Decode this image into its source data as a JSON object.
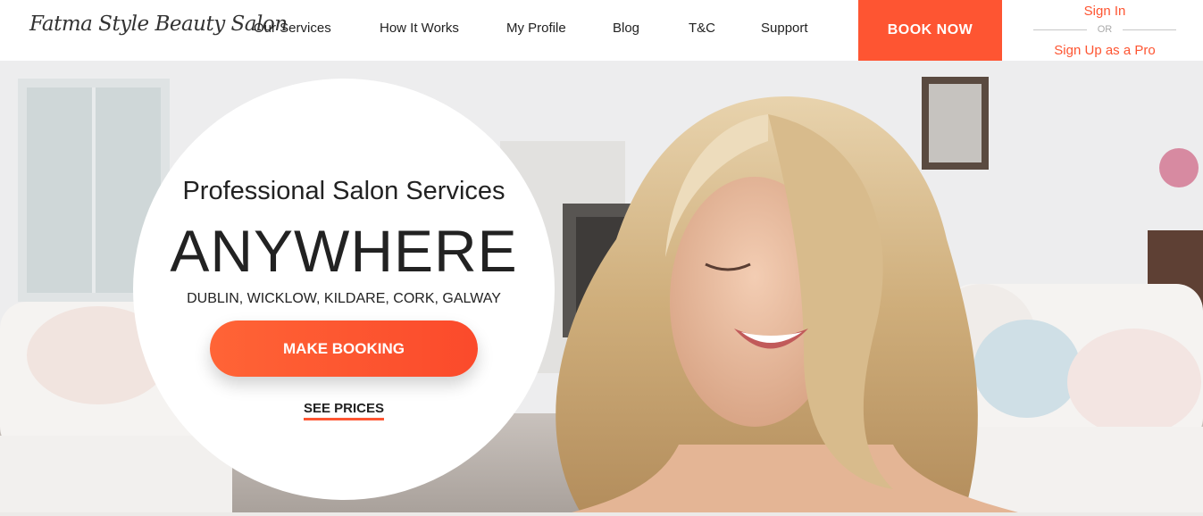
{
  "header": {
    "logo_text": "Fatma Style Beauty Salon",
    "nav": [
      {
        "label": "Our Services"
      },
      {
        "label": "How It Works"
      },
      {
        "label": "My Profile"
      },
      {
        "label": "Blog"
      },
      {
        "label": "T&C"
      },
      {
        "label": "Support"
      }
    ],
    "book_now_label": "BOOK NOW",
    "sign_in_label": "Sign In",
    "or_label": "OR",
    "sign_up_label": "Sign Up as a Pro"
  },
  "hero": {
    "subtitle": "Professional Salon Services",
    "title": "ANYWHERE",
    "cities": "DUBLIN, WICKLOW, KILDARE, CORK, GALWAY",
    "cta_label": "MAKE BOOKING",
    "secondary_link_label": "SEE PRICES"
  },
  "colors": {
    "accent": "#fe5532",
    "text": "#222222"
  }
}
